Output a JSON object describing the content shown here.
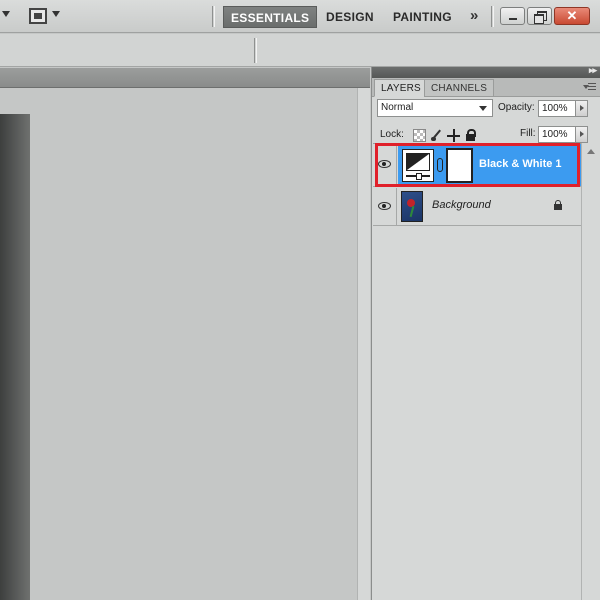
{
  "appbar": {
    "workspaces": [
      {
        "label": "ESSENTIALS",
        "active": true
      },
      {
        "label": "DESIGN",
        "active": false
      },
      {
        "label": "PAINTING",
        "active": false
      }
    ],
    "more_label": "»",
    "close_label": "✕"
  },
  "panel": {
    "tabs": [
      {
        "label": "LAYERS",
        "active": true
      },
      {
        "label": "CHANNELS",
        "active": false
      }
    ],
    "blend_mode": "Normal",
    "opacity_label": "Opacity:",
    "opacity_value": "100%",
    "lock_label": "Lock:",
    "fill_label": "Fill:",
    "fill_value": "100%",
    "layers": [
      {
        "name": "Black & White 1",
        "selected": true,
        "visible": true,
        "type": "adjustment"
      },
      {
        "name": "Background",
        "selected": false,
        "visible": true,
        "type": "image",
        "locked": true
      }
    ]
  },
  "colors": {
    "selection": "#3c9bf0",
    "highlight_outline": "#e0202a",
    "close_button": "#c94a33"
  }
}
